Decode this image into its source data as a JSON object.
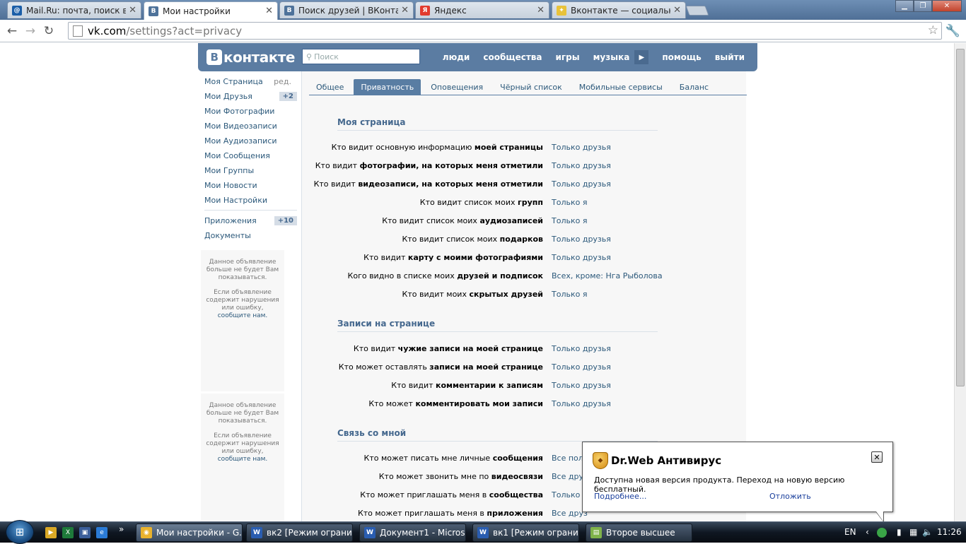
{
  "browser": {
    "tabs": [
      {
        "title": "Mail.Ru: почта, поиск в и",
        "icon": "mailru-icon"
      },
      {
        "title": "Мои настройки",
        "icon": "vk-icon"
      },
      {
        "title": "Поиск друзей | ВКонтакт",
        "icon": "vk-icon"
      },
      {
        "title": "Яндекс",
        "icon": "yandex-icon"
      },
      {
        "title": "Вконтакте — социальная",
        "icon": "lightbulb-icon"
      }
    ],
    "window_controls": {
      "minimize": "▁",
      "maximize": "❐",
      "close": "✕"
    },
    "url_host": "vk.com",
    "url_path": "/settings?act=privacy"
  },
  "vk": {
    "logo_letter": "В",
    "logo_text": "контакте",
    "search_placeholder": "Поиск",
    "top_nav": [
      "люди",
      "сообщества",
      "игры",
      "музыка",
      "помощь",
      "выйти"
    ],
    "left_nav": [
      {
        "label": "Моя Страница",
        "extra": "ред."
      },
      {
        "label": "Мои Друзья",
        "count": "+2"
      },
      {
        "label": "Мои Фотографии"
      },
      {
        "label": "Мои Видеозаписи"
      },
      {
        "label": "Мои Аудиозаписи"
      },
      {
        "label": "Мои Сообщения"
      },
      {
        "label": "Мои Группы"
      },
      {
        "label": "Мои Новости"
      },
      {
        "label": "Мои Настройки"
      }
    ],
    "left_nav2": [
      {
        "label": "Приложения",
        "count": "+10"
      },
      {
        "label": "Документы"
      }
    ],
    "ads": [
      {
        "p1": "Данное объявление больше не будет Вам показываться.",
        "p2": "Если объявление содержит нарушения или ошибку,",
        "link": "сообщите нам."
      },
      {
        "p1": "Данное объявление больше не будет Вам показываться.",
        "p2": "Если объявление содержит нарушения или ошибку,",
        "link": "сообщите нам."
      }
    ],
    "settings_tabs": [
      "Общее",
      "Приватность",
      "Оповещения",
      "Чёрный список",
      "Мобильные сервисы",
      "Баланс"
    ],
    "sections": [
      {
        "title": "Моя страница",
        "rows": [
          {
            "pre": "Кто видит основную информацию ",
            "bold": "моей страницы",
            "value": "Только друзья"
          },
          {
            "pre": "Кто видит ",
            "bold": "фотографии, на которых меня отметили",
            "value": "Только друзья"
          },
          {
            "pre": "Кто видит ",
            "bold": "видеозаписи, на которых меня отметили",
            "value": "Только друзья"
          },
          {
            "pre": "Кто видит список моих ",
            "bold": "групп",
            "value": "Только я"
          },
          {
            "pre": "Кто видит список моих ",
            "bold": "аудиозаписей",
            "value": "Только я"
          },
          {
            "pre": "Кто видит список моих ",
            "bold": "подарков",
            "value": "Только друзья"
          },
          {
            "pre": "Кто видит ",
            "bold": "карту с моими фотографиями",
            "value": "Только друзья"
          },
          {
            "pre": "Кого видно в списке моих ",
            "bold": "друзей и подписок",
            "value": "Всех, кроме: Нга Рыболова"
          },
          {
            "pre": "Кто видит моих ",
            "bold": "скрытых друзей",
            "value": "Только я"
          }
        ]
      },
      {
        "title": "Записи на странице",
        "rows": [
          {
            "pre": "Кто видит ",
            "bold": "чужие записи на моей странице",
            "value": "Только друзья"
          },
          {
            "pre": "Кто может оставлять ",
            "bold": "записи на моей странице",
            "value": "Только друзья"
          },
          {
            "pre": "Кто видит ",
            "bold": "комментарии к записям",
            "value": "Только друзья"
          },
          {
            "pre": "Кто может ",
            "bold": "комментировать мои записи",
            "value": "Только друзья"
          }
        ]
      },
      {
        "title": "Связь со мной",
        "rows": [
          {
            "pre": "Кто может писать мне личные ",
            "bold": "сообщения",
            "value": "Все поль"
          },
          {
            "pre": "Кто может звонить мне по ",
            "bold": "видеосвязи",
            "value": "Все друз"
          },
          {
            "pre": "Кто может приглашать меня в ",
            "bold": "сообщества",
            "value": "Только д"
          },
          {
            "pre": "Кто может приглашать меня в ",
            "bold": "приложения",
            "value": "Все друз"
          }
        ]
      }
    ]
  },
  "drweb": {
    "title": "Dr.Web Антивирус",
    "message": "Доступна новая версия продукта. Переход на новую версию бесплатный.",
    "more_link": "Подробнее...",
    "later_link": "Отложить",
    "close": "✕"
  },
  "taskbar": {
    "buttons": [
      {
        "label": "Мои настройки - G...",
        "icon": "chrome-icon"
      },
      {
        "label": "вк2 [Режим ограни...",
        "icon": "word-icon"
      },
      {
        "label": "Документ1 - Micros...",
        "icon": "word-icon"
      },
      {
        "label": "вк1 [Режим ограни...",
        "icon": "word-icon"
      },
      {
        "label": "Второе высшее",
        "icon": "notepad-icon"
      }
    ],
    "lang": "EN",
    "clock": "11:26",
    "chevron": "»"
  }
}
